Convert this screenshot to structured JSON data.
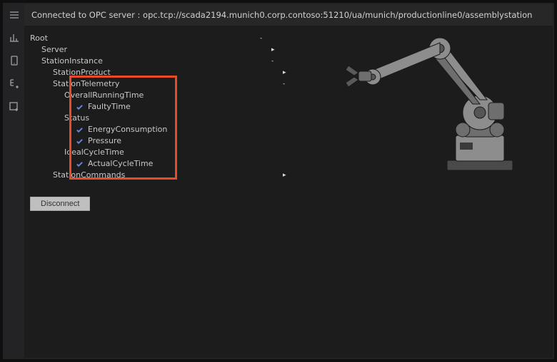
{
  "header": {
    "status_text": "Connected to OPC server : opc.tcp://scada2194.munich0.corp.contoso:51210/ua/munich/productionline0/assemblystation"
  },
  "tree": {
    "root": "Root",
    "server": "Server",
    "station_instance": "StationInstance",
    "station_product": "StationProduct",
    "station_telemetry": "StationTelemetry",
    "overall_running": "OverallRunningTime",
    "faulty_time": "FaultyTime",
    "status": "Status",
    "energy": "EnergyConsumption",
    "pressure": "Pressure",
    "ideal_cycle": "IdealCycleTime",
    "actual_cycle": "ActualCycleTime",
    "station_commands": "StationCommands"
  },
  "buttons": {
    "disconnect": "Disconnect"
  },
  "icons": {
    "check": "checkmark-icon",
    "menu": "hamburger-icon",
    "chart": "chart-icon",
    "tablet": "tablet-icon",
    "tree_add": "tree-add-icon",
    "add": "add-icon",
    "expand": "▸",
    "unexp": "-"
  },
  "colors": {
    "highlight": "#ea4a27",
    "check_blue": "#6b88e6"
  }
}
